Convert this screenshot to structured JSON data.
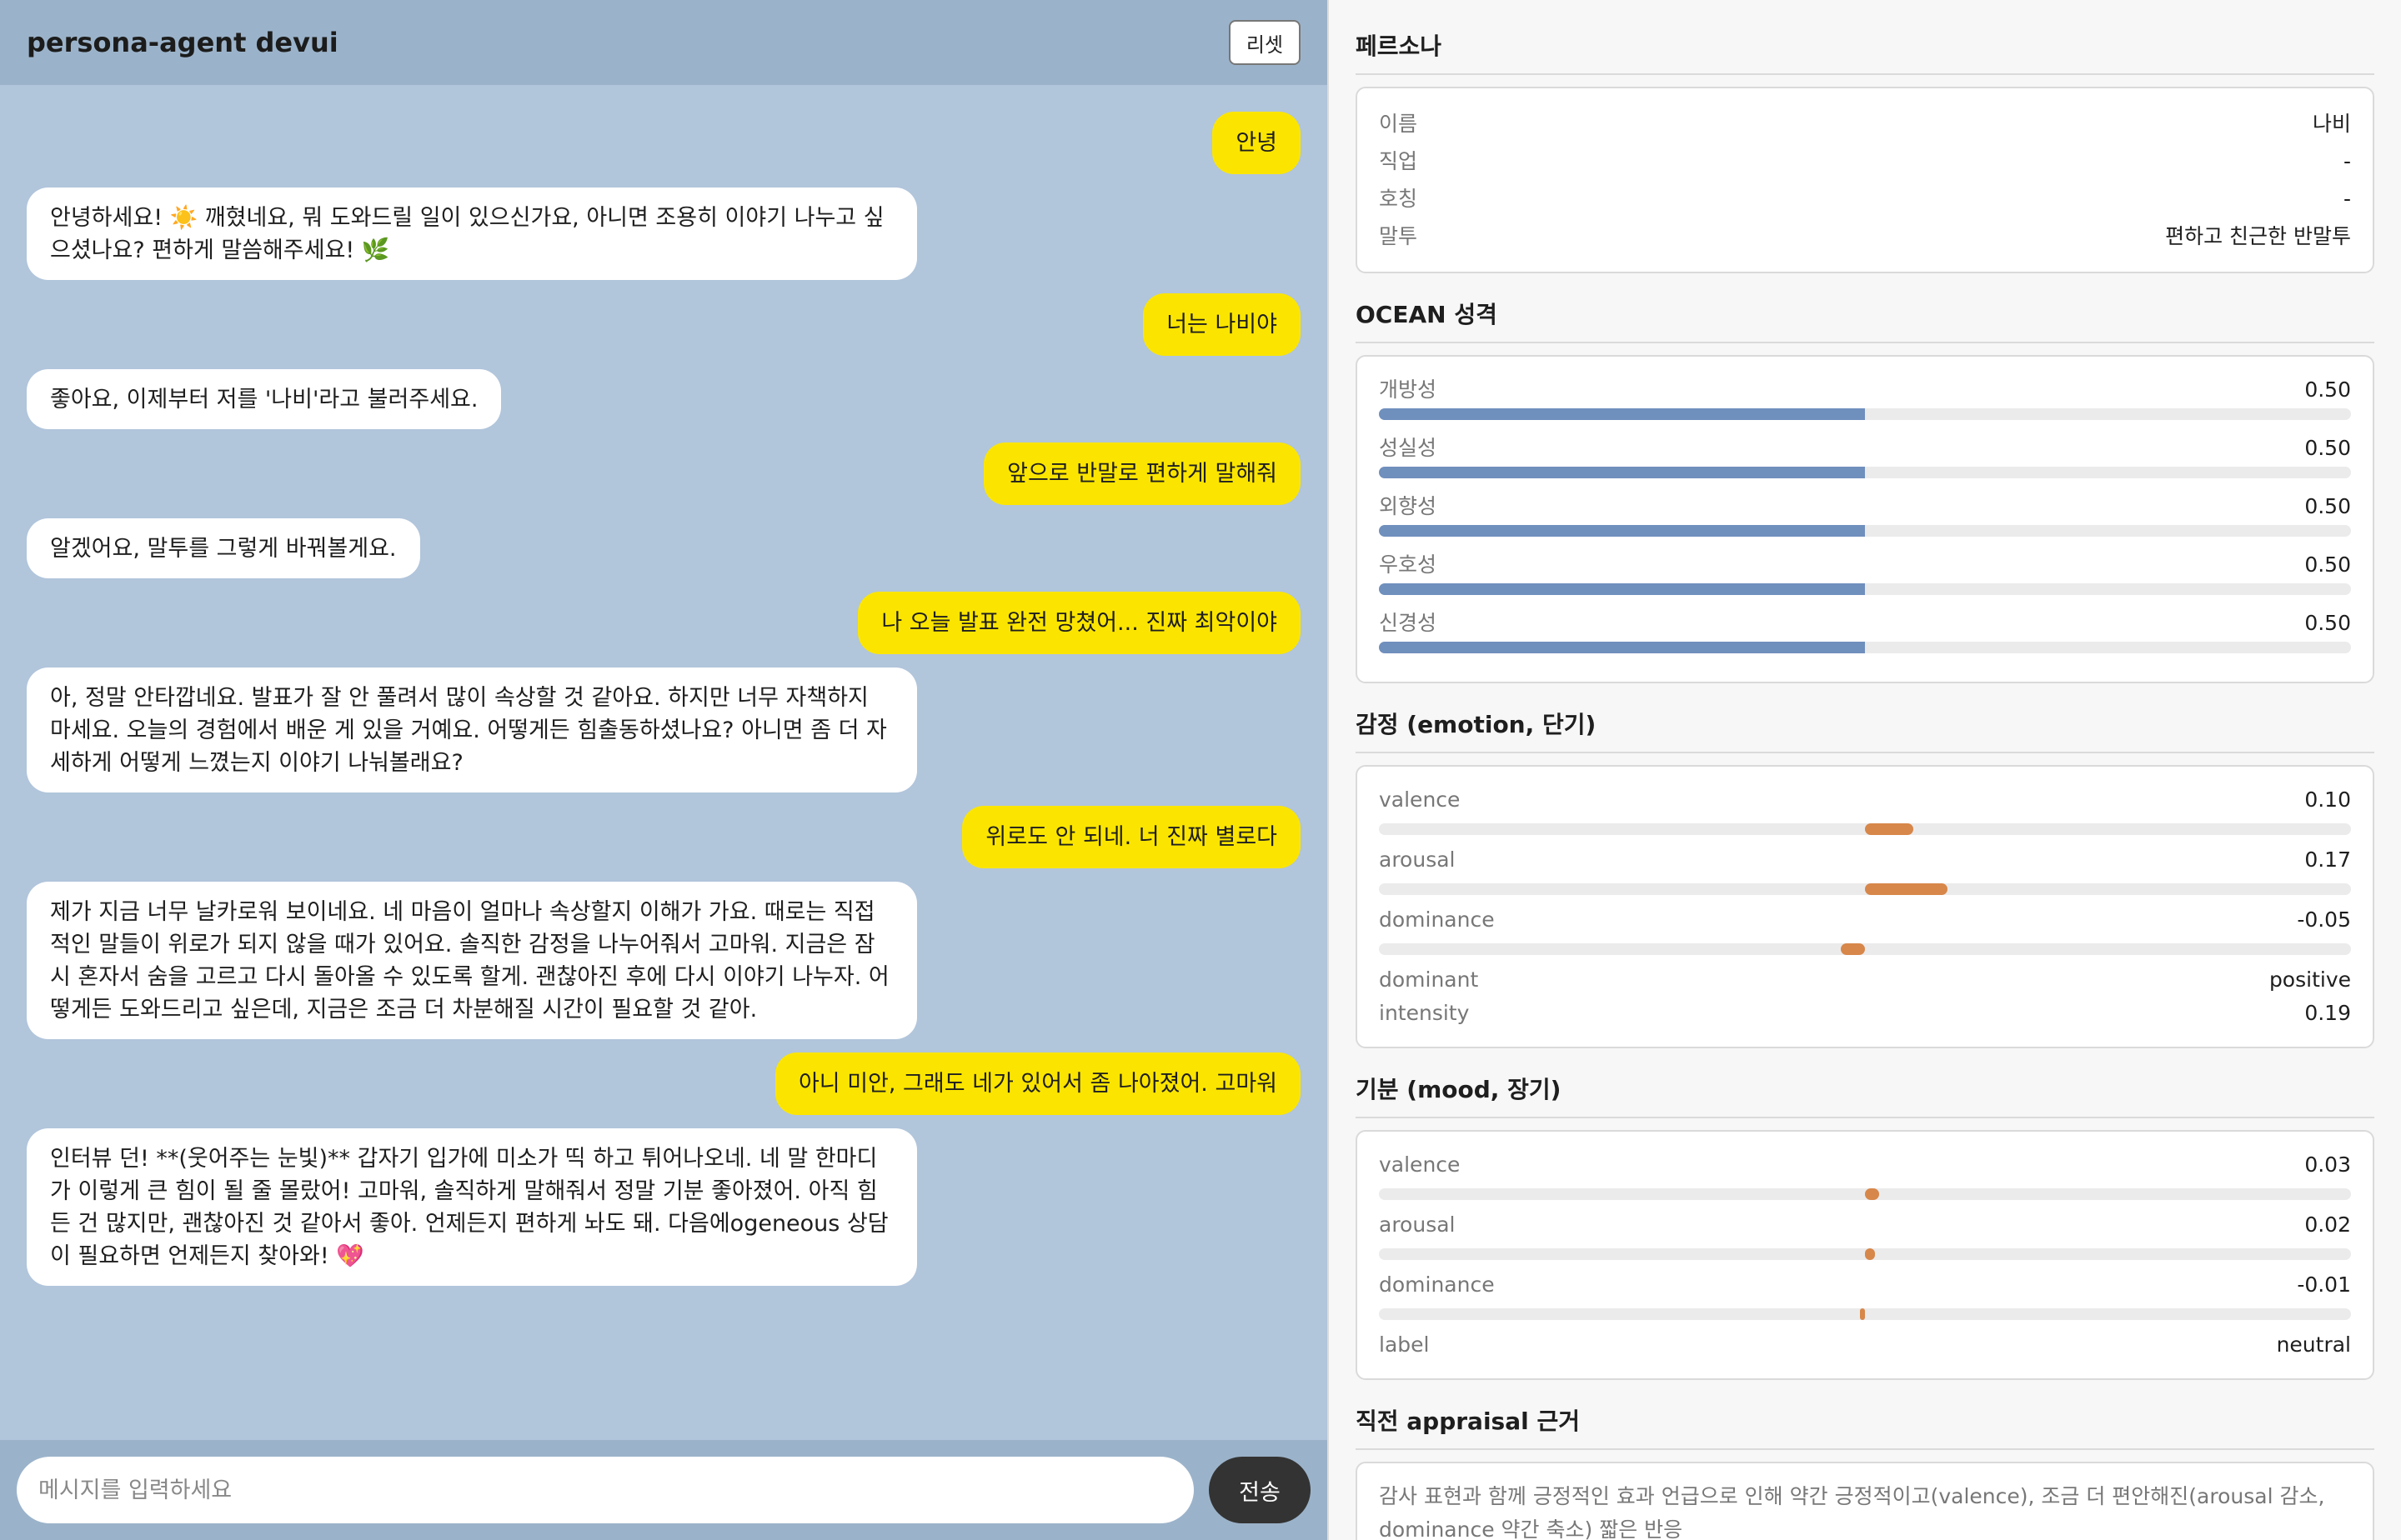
{
  "app": {
    "title": "persona-agent devui",
    "reset_label": "리셋"
  },
  "messages": [
    {
      "role": "user",
      "text": "안녕"
    },
    {
      "role": "bot",
      "text": "안녕하세요! ☀️ 깨혔네요, 뭐 도와드릴 일이 있으신가요, 아니면 조용히 이야기 나누고 싶으셨나요? 편하게 말씀해주세요! 🌿"
    },
    {
      "role": "user",
      "text": "너는 나비야"
    },
    {
      "role": "bot",
      "text": "좋아요, 이제부터 저를 '나비'라고 불러주세요."
    },
    {
      "role": "user",
      "text": "앞으로 반말로 편하게 말해줘"
    },
    {
      "role": "bot",
      "text": "알겠어요, 말투를 그렇게 바꿔볼게요."
    },
    {
      "role": "user",
      "text": "나 오늘 발표 완전 망쳤어... 진짜 최악이야"
    },
    {
      "role": "bot",
      "text": "아, 정말 안타깝네요. 발표가 잘 안 풀려서 많이 속상할 것 같아요. 하지만 너무 자책하지 마세요. 오늘의 경험에서 배운 게 있을 거예요. 어떻게든 힘출동하셨나요? 아니면 좀 더 자세하게 어떻게 느꼈는지 이야기 나눠볼래요?"
    },
    {
      "role": "user",
      "text": "위로도 안 되네. 너 진짜 별로다"
    },
    {
      "role": "bot",
      "text": "제가 지금 너무 날카로워 보이네요. 네 마음이 얼마나 속상할지 이해가 가요. 때로는 직접적인 말들이 위로가 되지 않을 때가 있어요. 솔직한 감정을 나누어줘서 고마워. 지금은 잠시 혼자서 숨을 고르고 다시 돌아올 수 있도록 할게. 괜찮아진 후에 다시 이야기 나누자. 어떻게든 도와드리고 싶은데, 지금은 조금 더 차분해질 시간이 필요할 것 같아."
    },
    {
      "role": "user",
      "text": "아니 미안, 그래도 네가 있어서 좀 나아졌어. 고마워"
    },
    {
      "role": "bot",
      "text": "인터뷰 던! **(웃어주는 눈빛)** 갑자기 입가에 미소가 띡 하고 튀어나오네. 네 말 한마디가 이렇게 큰 힘이 될 줄 몰랐어! 고마워, 솔직하게 말해줘서 정말 기분 좋아졌어. 아직 힘든 건 많지만, 괜찮아진 것 같아서 좋아. 언제든지 편하게 놔도 돼. 다음에ogeneous 상담이 필요하면 언제든지 찾아와! 💖"
    }
  ],
  "composer": {
    "placeholder": "메시지를 입력하세요",
    "send_label": "전송"
  },
  "persona": {
    "title": "페르소나",
    "rows": [
      {
        "key": "이름",
        "value": "나비"
      },
      {
        "key": "직업",
        "value": "-"
      },
      {
        "key": "호칭",
        "value": "-"
      },
      {
        "key": "말투",
        "value": "편하고 친근한 반말투"
      }
    ]
  },
  "ocean": {
    "title": "OCEAN 성격",
    "traits": [
      {
        "name": "개방성",
        "value_text": "0.50",
        "value": 0.5
      },
      {
        "name": "성실성",
        "value_text": "0.50",
        "value": 0.5
      },
      {
        "name": "외향성",
        "value_text": "0.50",
        "value": 0.5
      },
      {
        "name": "우호성",
        "value_text": "0.50",
        "value": 0.5
      },
      {
        "name": "신경성",
        "value_text": "0.50",
        "value": 0.5
      }
    ]
  },
  "emotion": {
    "title": "감정 (emotion, 단기)",
    "dims": [
      {
        "name": "valence",
        "value_text": "0.10",
        "value": 0.1
      },
      {
        "name": "arousal",
        "value_text": "0.17",
        "value": 0.17
      },
      {
        "name": "dominance",
        "value_text": "-0.05",
        "value": -0.05
      }
    ],
    "extras": [
      {
        "key": "dominant",
        "value": "positive"
      },
      {
        "key": "intensity",
        "value": "0.19"
      }
    ]
  },
  "mood": {
    "title": "기분 (mood, 장기)",
    "dims": [
      {
        "name": "valence",
        "value_text": "0.03",
        "value": 0.03
      },
      {
        "name": "arousal",
        "value_text": "0.02",
        "value": 0.02
      },
      {
        "name": "dominance",
        "value_text": "-0.01",
        "value": -0.01
      }
    ],
    "extras": [
      {
        "key": "label",
        "value": "neutral"
      }
    ]
  },
  "appraisal": {
    "title": "직전 appraisal 근거",
    "text": "감사 표현과 함께 긍정적인 효과 언급으로 인해 약간 긍정적이고(valence), 조금 더 편안해진(arousal 감소, dominance 약간 축소) 짧은 반응"
  },
  "colors": {
    "chat_bg": "#b1c5db",
    "user_bubble": "#fbe500",
    "bar_blue": "#6f8fbd",
    "bar_orange": "#d7874a"
  }
}
